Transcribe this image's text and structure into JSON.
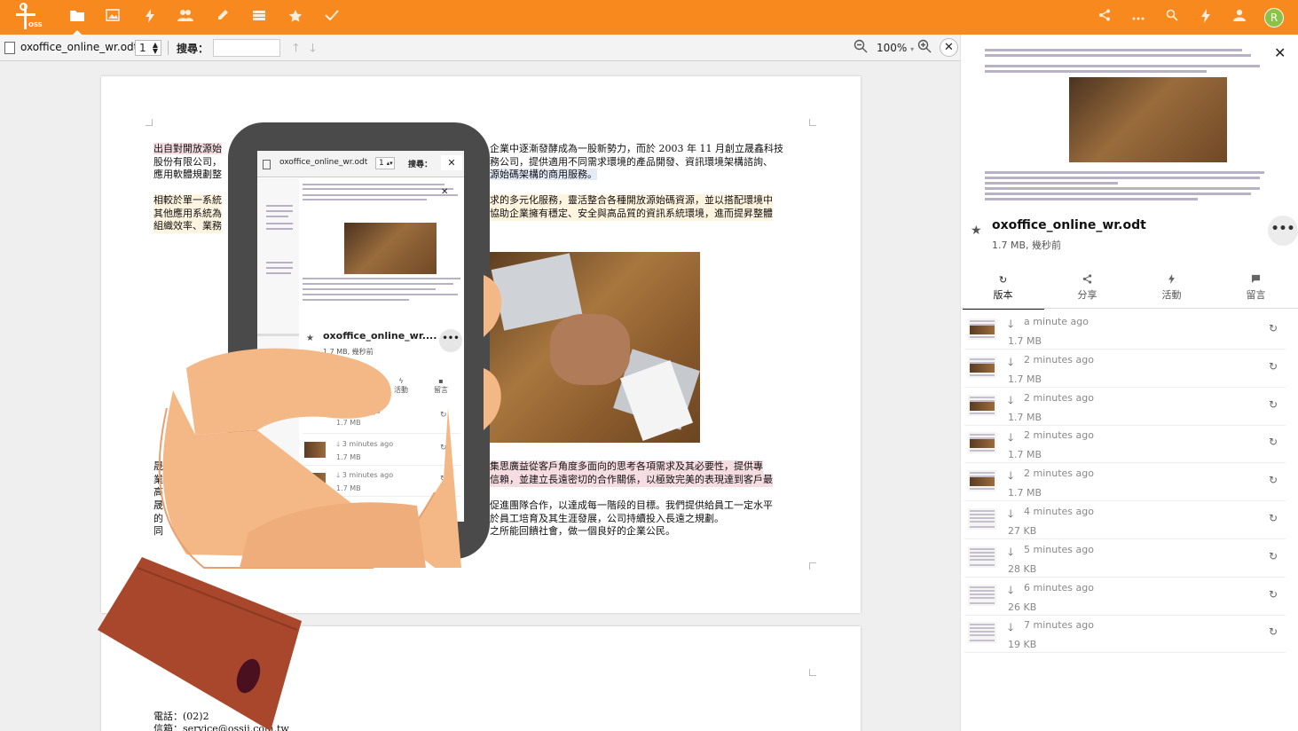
{
  "app": {
    "logo_text": "OSS",
    "nav_icons": [
      "folder-icon",
      "image-icon",
      "activity-icon",
      "contacts-icon",
      "pencil-icon",
      "deck-icon",
      "star-icon",
      "tasks-icon"
    ],
    "right_icons": [
      "share-icon",
      "more-icon",
      "search-icon",
      "notifications-icon",
      "contacts-menu-icon"
    ],
    "avatar_letter": "R",
    "accent": "#f7891e"
  },
  "doc_toolbar": {
    "file_name": "oxoffice_online_wr.odt",
    "page": "1",
    "search_label": "搜尋：",
    "search_value": "",
    "zoom": "100%",
    "close": "✕"
  },
  "document": {
    "p1": [
      "出自對開放源始",
      "企業中逐漸發酵成為一股新勢力，而於 2003 年 11 月創立晟鑫科技",
      "股份有限公司，",
      "務公司，提供適用不同需求環境的產品開發、資訊環境架構諮詢、",
      "應用軟體規劃整",
      "源始碼架構的商用服務。"
    ],
    "p2": [
      "相較於單一系統",
      "求的多元化服務，靈活整合各種開放源始碼資源，並以搭配環境中",
      "其他應用系統為",
      "協助企業擁有穩定、安全與高品質的資訊系統環境，進而提昇整體",
      "組織效率、業務"
    ],
    "p3": [
      "晟",
      "集思廣益從客戶角度多面向的思考各項需求及其必要性，提供專",
      "業",
      "信賴，並建立長遠密切的合作關係，以極致完美的表現達到客戶最",
      "高",
      "晟",
      "促進團隊合作，以達成每一階段的目標。我們提供給員工一定水平",
      "的",
      "於員工培育及其生涯發展，公司持續投入長遠之規劃。",
      "同",
      "之所能回饋社會，做一個良好的企業公民。"
    ],
    "footer_phone": "電話：(02)2",
    "footer_mail": "信箱：service@ossii.com.tw"
  },
  "sidebar": {
    "file_name": "oxoffice_online_wr.odt",
    "file_meta": "1.7 MB, 幾秒前",
    "more": "•••",
    "close": "✕",
    "tabs": [
      {
        "label": "版本",
        "icon": "history-icon"
      },
      {
        "label": "分享",
        "icon": "share-icon"
      },
      {
        "label": "活動",
        "icon": "activity-icon"
      },
      {
        "label": "留言",
        "icon": "comment-icon"
      }
    ],
    "versions": [
      {
        "time": "a minute ago",
        "size": "1.7 MB"
      },
      {
        "time": "2 minutes ago",
        "size": "1.7 MB"
      },
      {
        "time": "2 minutes ago",
        "size": "1.7 MB"
      },
      {
        "time": "2 minutes ago",
        "size": "1.7 MB"
      },
      {
        "time": "2 minutes ago",
        "size": "1.7 MB"
      },
      {
        "time": "4 minutes ago",
        "size": "27 KB"
      },
      {
        "time": "5 minutes ago",
        "size": "28 KB"
      },
      {
        "time": "6 minutes ago",
        "size": "26 KB"
      },
      {
        "time": "7 minutes ago",
        "size": "19 KB"
      }
    ]
  },
  "phone": {
    "file_name": "oxoffice_online_wr.odt",
    "page": "1",
    "search_label": "搜尋：",
    "close": "✕",
    "side_file_name": "oxoffice_online_wr....",
    "side_meta": "1.7 MB, 幾秒前",
    "tabs": [
      "活動",
      "留言"
    ],
    "versions": [
      {
        "time": "3 minutes ago",
        "size": "1.7 MB"
      },
      {
        "time": "3 minutes ago",
        "size": "1.7 MB"
      },
      {
        "time": "3 minutes ago",
        "size": "1.7 MB"
      },
      {
        "time": "3 minutes ago",
        "size": ""
      }
    ],
    "first_time": "minutes ago"
  }
}
